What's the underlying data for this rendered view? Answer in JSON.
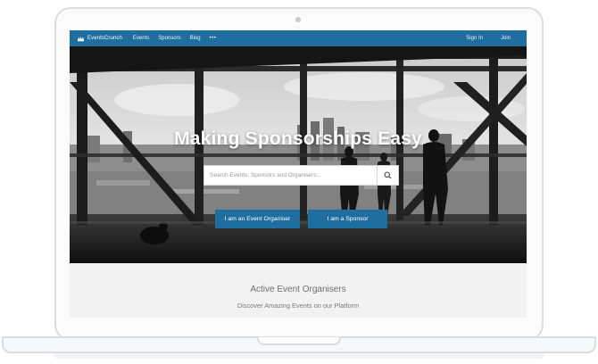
{
  "navbar": {
    "brand": "EventsCrunch",
    "links": [
      "Events",
      "Sponsors",
      "Blog"
    ],
    "more": "•••",
    "right_links": [
      "Sign In",
      "Join"
    ]
  },
  "hero": {
    "title": "Making Sponsorships Easy",
    "search_placeholder": "Search Events, Sponsors and Organisers...",
    "buttons": {
      "organiser": "I am an Event Organiser",
      "sponsor": "I am a Sponsor"
    }
  },
  "section": {
    "title": "Active Event Organisers",
    "subtitle": "Discover Amazing Events on our Platform"
  },
  "colors": {
    "brand": "#1f6e9f",
    "section_bg": "#f2f2f2"
  },
  "icons": {
    "brand": "crown-icon",
    "search": "search-icon"
  }
}
